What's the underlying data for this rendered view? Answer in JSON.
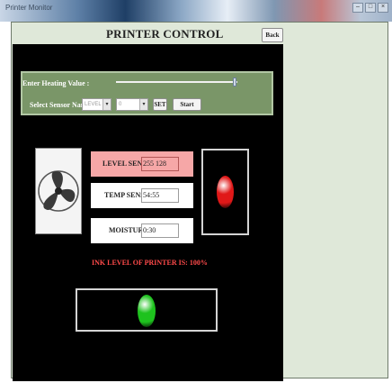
{
  "window": {
    "title_text": "Printer Monitor",
    "controls": [
      "–",
      "□",
      "×"
    ]
  },
  "app": {
    "title": "PRINTER CONTROL",
    "back_label": "Back"
  },
  "controls": {
    "heating_label": "Enter Heating Value :",
    "heating_level": 0.98,
    "sensor_label": "Select Sensor Name",
    "sensor_select_value": "LEVEL",
    "value_select_value": "0",
    "set_label": "SET",
    "start_label": "Start"
  },
  "sensors": [
    {
      "name": "LEVEL SENSOR",
      "value": "255 128",
      "highlight": true
    },
    {
      "name": "TEMP SENSOR",
      "value": "54:55",
      "highlight": false
    },
    {
      "name": "MOISTURE",
      "value": "0:30",
      "highlight": false
    }
  ],
  "ink_level_text": "INK LEVEL OF PRINTER IS: 100%",
  "indicators": {
    "alarm_color": "#e01818",
    "status_color": "#1ec21e"
  },
  "colors": {
    "panel": "#7a9668",
    "highlight": "#f6a7a7",
    "ink_text": "#ff4a4a"
  }
}
